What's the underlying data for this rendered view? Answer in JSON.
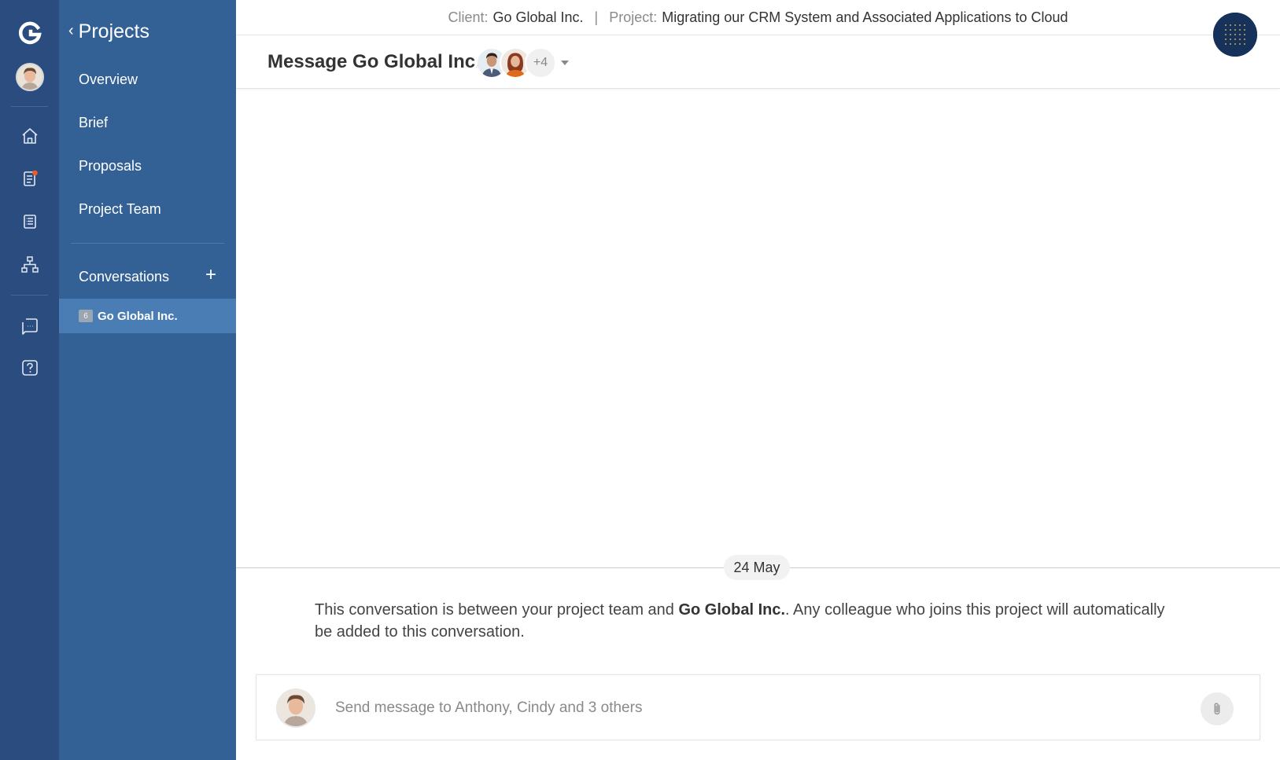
{
  "app": {
    "logo_letter": "G"
  },
  "rail": {
    "icons": [
      {
        "name": "home-icon"
      },
      {
        "name": "briefs-icon",
        "has_notification": true
      },
      {
        "name": "documents-icon"
      },
      {
        "name": "org-chart-icon"
      },
      {
        "name": "chat-icon"
      },
      {
        "name": "help-icon"
      }
    ],
    "notification_color": "#f05a28"
  },
  "sidebar": {
    "back_label": "Projects",
    "nav_items": [
      {
        "label": "Overview"
      },
      {
        "label": "Brief"
      },
      {
        "label": "Proposals"
      },
      {
        "label": "Project Team"
      }
    ],
    "conversations_label": "Conversations",
    "add_label": "+",
    "conversation": {
      "badge": "6",
      "name": "Go Global Inc."
    }
  },
  "topbar": {
    "client_label": "Client:",
    "client_value": "Go Global Inc.",
    "separator": "|",
    "project_label": "Project:",
    "project_value": "Migrating our CRM System and Associated Applications to Cloud"
  },
  "conversation_header": {
    "title": "Message Go Global Inc.",
    "more_count": "+4"
  },
  "messages": {
    "date_label": "24 May",
    "intro_pre": "This conversation is between your project team and ",
    "intro_bold": "Go Global Inc.",
    "intro_post": ". Any colleague who joins this project will automatically be added to this conversation."
  },
  "composer": {
    "placeholder": "Send message to Anthony, Cindy and 3 others"
  },
  "colors": {
    "rail_bg": "#2a4c7e",
    "sidebar_bg": "#336196",
    "sidebar_active": "#4a7db3",
    "corner_avatar_bg": "#17325a"
  }
}
